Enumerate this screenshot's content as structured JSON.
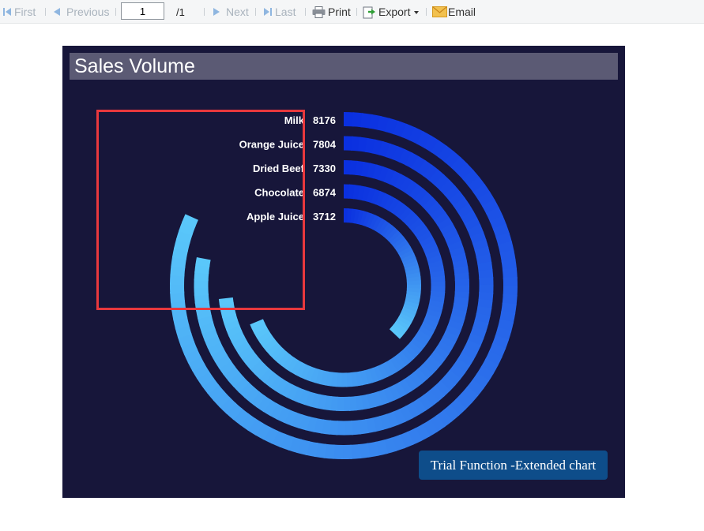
{
  "toolbar": {
    "first_label": "First",
    "previous_label": "Previous",
    "page_value": "1",
    "page_total": "/1",
    "next_label": "Next",
    "last_label": "Last",
    "print_label": "Print",
    "export_label": "Export",
    "email_label": "Email"
  },
  "report": {
    "title": "Sales Volume",
    "trial_text": "Trial Function -Extended chart"
  },
  "chart_data": {
    "type": "radial-bar",
    "title": "Sales Volume",
    "categories": [
      "Milk",
      "Orange Juice",
      "Dried Beef",
      "Chocolate",
      "Apple Juice"
    ],
    "values": [
      8176,
      7804,
      7330,
      6874,
      3712
    ],
    "max": 10000,
    "colors": {
      "start": "#0a2fe0",
      "end": "#5ac8fa"
    }
  }
}
